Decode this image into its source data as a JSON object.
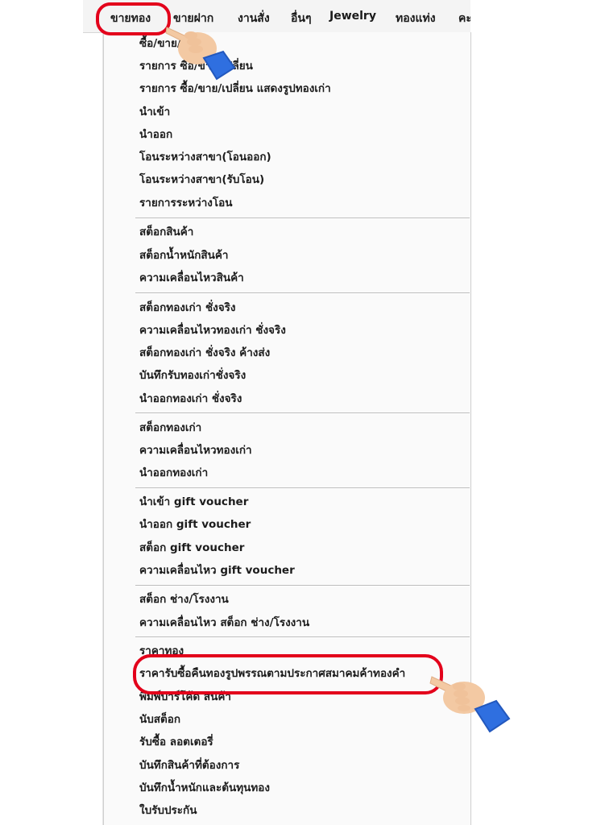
{
  "menubar": {
    "items": [
      "ขายทอง",
      "ขายฝาก",
      "งานสั่ง",
      "อื่นๆ",
      "Jewelry",
      "ทองแท่ง",
      "คะ"
    ]
  },
  "dropdown": {
    "items": [
      "ซื้อ/ขาย/เปลี่ยน",
      "รายการ ซื้อ/ขาย/เปลี่ยน",
      "รายการ ซื้อ/ขาย/เปลี่ยน แสดงรูปทองเก่า",
      "นำเข้า",
      "นำออก",
      "โอนระหว่างสาขา(โอนออก)",
      "โอนระหว่างสาขา(รับโอน)",
      "รายการระหว่างโอน",
      "สต็อกสินค้า",
      "สต็อกน้ำหนักสินค้า",
      "ความเคลื่อนไหวสินค้า",
      "สต็อกทองเก่า ชั่งจริง",
      "ความเคลื่อนไหวทองเก่า ชั่งจริง",
      "สต็อกทองเก่า ชั่งจริง ค้างส่ง",
      "บันทึกรับทองเก่าชั่งจริง",
      "นำออกทองเก่า ชั่งจริง",
      "สต็อกทองเก่า",
      "ความเคลื่อนไหวทองเก่า",
      "นำออกทองเก่า",
      "นำเข้า gift voucher",
      "นำออก gift voucher",
      "สต็อก gift voucher",
      "ความเคลื่อนไหว gift voucher",
      "สต็อก ช่าง/โรงงาน",
      "ความเคลื่อนไหว สต็อก ช่าง/โรงงาน",
      "ราคาทอง",
      "ราคารับซื้อคืนทองรูปพรรณตามประกาศสมาคมค้าทองคำ",
      "พิมพ์บาร์โค้ด สินค้า",
      "นับสต็อก",
      "รับซื้อ ลอตเตอรี่",
      "บันทึกสินค้าที่ต้องการ",
      "บันทึกน้ำหนักและต้นทุนทอง",
      "ใบรับประกัน"
    ]
  },
  "colors": {
    "highlight": "#e3001b",
    "cuff": "#2f6fe0",
    "skin": "#f3c9a3"
  },
  "icons": [
    "pointing-hand-icon",
    "pointing-hand-icon"
  ]
}
